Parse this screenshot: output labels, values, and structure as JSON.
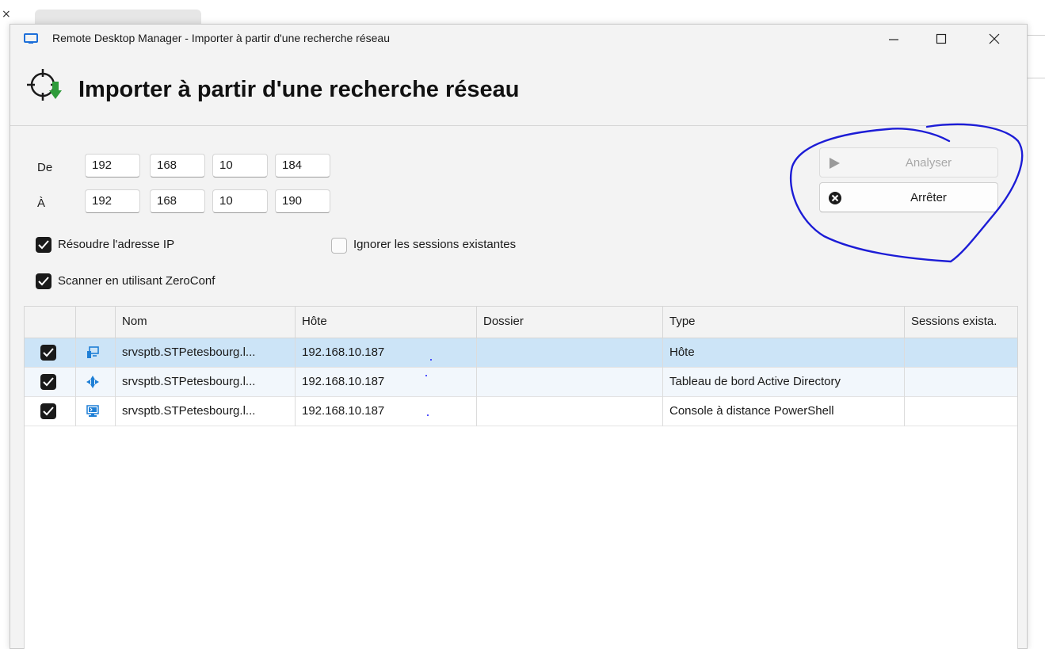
{
  "window": {
    "title": "Remote Desktop Manager - Importer à partir d'une recherche réseau",
    "minimize_label": "—",
    "maximize_label": "☐",
    "close_label": "✕"
  },
  "header": {
    "title": "Importer à partir d'une recherche réseau"
  },
  "range": {
    "from_label": "De",
    "to_label": "À",
    "from": [
      "192",
      "168",
      "10",
      "184"
    ],
    "to": [
      "192",
      "168",
      "10",
      "190"
    ]
  },
  "options": {
    "resolve_ip": {
      "label": "Résoudre l'adresse IP",
      "checked": true
    },
    "ignore_existing": {
      "label": "Ignorer les sessions existantes",
      "checked": false
    },
    "zeroconf": {
      "label": "Scanner en utilisant ZeroConf",
      "checked": true
    }
  },
  "buttons": {
    "analyze": {
      "label": "Analyser",
      "enabled": false,
      "icon": "play-icon"
    },
    "stop": {
      "label": "Arrêter",
      "enabled": true,
      "icon": "stop-circle-icon"
    }
  },
  "table": {
    "columns": [
      "",
      "",
      "Nom",
      "Hôte",
      "Dossier",
      "Type",
      "Sessions exista."
    ],
    "rows": [
      {
        "checked": true,
        "icon": "host-icon",
        "name": "srvsptb.STPetesbourg.l...",
        "host": "192.168.10.187",
        "folder": "",
        "type": "Hôte",
        "sessions": ""
      },
      {
        "checked": true,
        "icon": "active-directory-icon",
        "name": "srvsptb.STPetesbourg.l...",
        "host": "192.168.10.187",
        "folder": "",
        "type": "Tableau de bord Active Directory",
        "sessions": ""
      },
      {
        "checked": true,
        "icon": "powershell-icon",
        "name": "srvsptb.STPetesbourg.l...",
        "host": "192.168.10.187",
        "folder": "",
        "type": "Console à distance PowerShell",
        "sessions": ""
      }
    ]
  },
  "colors": {
    "annotation": "#1c1cd6",
    "selected_row": "#cce4f7",
    "accent": "#0078d4"
  }
}
